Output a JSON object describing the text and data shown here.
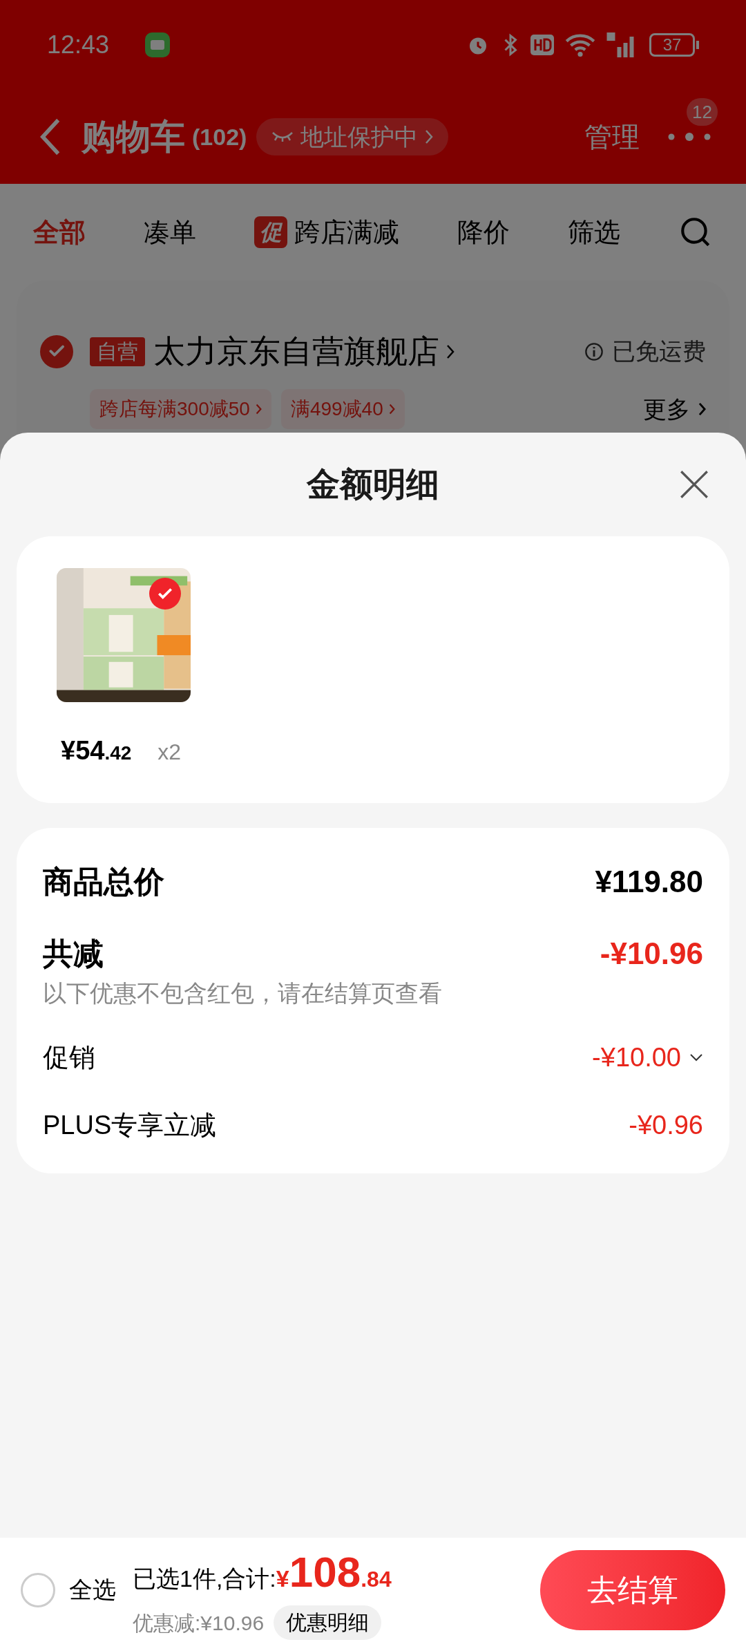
{
  "status_bar": {
    "time": "12:43",
    "battery": "37"
  },
  "header": {
    "title": "购物车",
    "count": "(102)",
    "address_badge": "地址保护中",
    "manage": "管理",
    "more_badge": "12"
  },
  "tabs": [
    {
      "label": "全部",
      "selected": true
    },
    {
      "label": "凑单",
      "selected": false
    },
    {
      "label": "跨店满减",
      "selected": false,
      "tag": "促"
    },
    {
      "label": "降价",
      "selected": false
    },
    {
      "label": "筛选",
      "selected": false
    }
  ],
  "store": {
    "checked": true,
    "tag": "自营",
    "name": "太力京东自营旗舰店",
    "shipping": "已免运费",
    "promos": [
      "跨店每满300减50",
      "满499减40"
    ],
    "more": "更多"
  },
  "sheet": {
    "title": "金额明细",
    "items": [
      {
        "kind": "picture",
        "selected": true,
        "price_main": "¥54",
        "price_decimal": ".42",
        "quantity": "x2"
      }
    ],
    "summary": {
      "total_label": "商品总价",
      "total": "¥119.80",
      "discount_label": "共减",
      "discount": "-¥10.96",
      "note": "以下优惠不包含红包，请在结算页查看",
      "rows": [
        {
          "label": "促销",
          "value": "-¥10.00",
          "expandable": true
        },
        {
          "label": "PLUS专享立减",
          "value": "-¥0.96",
          "expandable": false
        }
      ]
    }
  },
  "footer": {
    "select_all": {
      "label": "全选",
      "checked": false
    },
    "selected_text": "已选1件,合计:",
    "currency": "¥",
    "total_main": "108",
    "total_decimal": ".84",
    "discount_text": "优惠减:¥10.96",
    "detail_button": "优惠明细",
    "checkout": "去结算"
  }
}
